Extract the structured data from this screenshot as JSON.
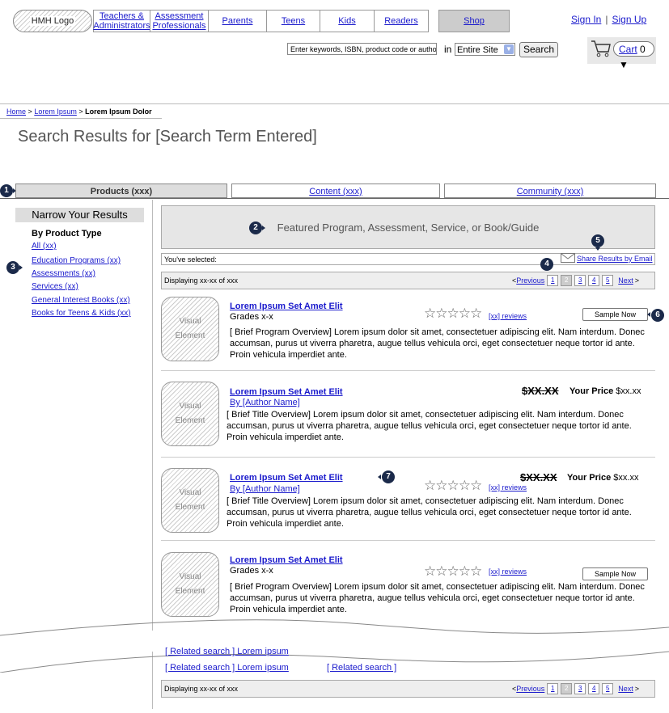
{
  "header": {
    "logo": "HMH Logo",
    "nav": [
      {
        "line1": "Teachers &",
        "line2": "Administrators"
      },
      {
        "line1": "Assessment",
        "line2": "Professionals"
      },
      {
        "line1": "Parents",
        "line2": ""
      },
      {
        "line1": "Teens",
        "line2": ""
      },
      {
        "line1": "Kids",
        "line2": ""
      },
      {
        "line1": "Readers",
        "line2": ""
      },
      {
        "line1": "Shop",
        "line2": ""
      }
    ],
    "sign_in": "Sign In",
    "sign_sep": "|",
    "sign_up": "Sign Up",
    "search_placeholder": "Enter keywords, ISBN, product code or author",
    "in_label": "in",
    "scope_value": "Entire Site",
    "search_button": "Search",
    "cart_label": "Cart",
    "cart_count": "0 ▼"
  },
  "breadcrumb": {
    "home": "Home",
    "sep1": ">",
    "level1": "Lorem Ipsum",
    "sep2": ">",
    "current": "Lorem Ipsum Dolor"
  },
  "page_title": "Search Results for [Search Term Entered]",
  "tabs": [
    {
      "label": "Products (xxx)"
    },
    {
      "label": "Content (xxx)"
    },
    {
      "label": "Community (xxx)"
    }
  ],
  "annotations": [
    "1",
    "2",
    "3",
    "4",
    "5",
    "6",
    "7"
  ],
  "sidebar": {
    "title": "Narrow Your Results",
    "heading": "By Product Type",
    "items": [
      "All (xx)",
      "Education Programs (xx)",
      "Assessments (xx)",
      "Services (xx)",
      "General Interest Books (xx)",
      "Books for Teens & Kids (xx)"
    ]
  },
  "featured": "Featured Program, Assessment, Service, or Book/Guide",
  "selected_label": "You've selected:",
  "share_label": "Share Results by Email",
  "paging": {
    "display": "Displaying xx-xx of xxx",
    "prev": "Previous",
    "prev_prefix": "<",
    "pages": [
      "1",
      "2",
      "3",
      "4",
      "5"
    ],
    "current": "2",
    "next": "Next",
    "next_suffix": ">"
  },
  "results": [
    {
      "visual": "Visual Element",
      "title": "Lorem Ipsum Set Amet Elit",
      "sub": "Grades x-x",
      "stars": "☆☆☆☆☆",
      "reviews": "[xx] reviews",
      "button": "Sample Now",
      "desc": "[ Brief Program Overview] Lorem ipsum dolor sit amet, consectetuer adipiscing elit. Nam interdum. Donec accumsan, purus ut viverra pharetra, augue tellus vehicula orci, eget consectetuer neque tortor id ante. Proin vehicula imperdiet ante."
    },
    {
      "visual": "Visual Element",
      "title": "Lorem Ipsum Set Amet Elit",
      "sub": "By [Author Name]",
      "old_price": "$XX.XX",
      "price_label": "Your Price",
      "price": "$xx.xx",
      "desc": "[ Brief Title Overview] Lorem ipsum dolor sit amet, consectetuer adipiscing elit. Nam interdum. Donec accumsan, purus ut viverra pharetra, augue tellus vehicula orci, eget consectetuer neque tortor id ante. Proin vehicula imperdiet ante."
    },
    {
      "visual": "Visual Element",
      "title": "Lorem Ipsum Set Amet Elit",
      "sub": "By [Author Name]",
      "stars": "☆☆☆☆☆",
      "reviews": "[xx] reviews",
      "old_price": "$XX.XX",
      "price_label": "Your Price",
      "price": "$xx.xx",
      "desc": "[ Brief Title Overview] Lorem ipsum dolor sit amet, consectetuer adipiscing elit. Nam interdum. Donec accumsan, purus ut viverra pharetra, augue tellus vehicula orci, eget consectetuer neque tortor id ante. Proin vehicula imperdiet ante."
    },
    {
      "visual": "Visual Element",
      "title": "Lorem Ipsum Set Amet Elit",
      "sub": "Grades x-x",
      "stars": "☆☆☆☆☆",
      "reviews": "[xx] reviews",
      "button": "Sample Now",
      "desc": "[ Brief Program Overview] Lorem ipsum dolor sit amet, consectetuer adipiscing elit. Nam interdum. Donec accumsan, purus ut viverra pharetra, augue tellus vehicula orci, eget consectetuer neque tortor id ante. Proin vehicula imperdiet ante."
    }
  ],
  "related": {
    "item1": "[ Related search ] Lorem ipsum",
    "item2": "[ Related search ] Lorem ipsum",
    "item3": "[ Related search ]"
  },
  "colors": {
    "badge": "#1b2a4a",
    "link": "#1a1acc",
    "panel": "#e6e6e6"
  }
}
